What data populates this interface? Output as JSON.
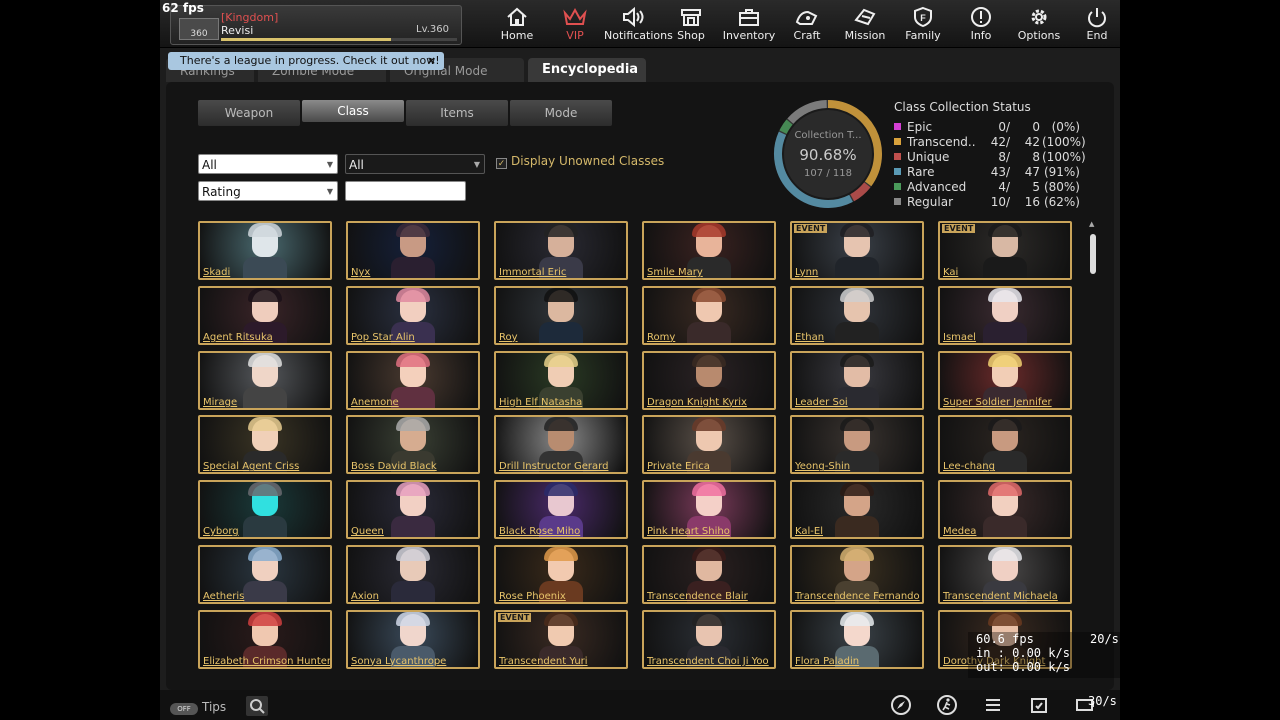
{
  "fps": "62 fps",
  "profile": {
    "guild": "[Kingdom]",
    "name": "Revisi",
    "level": "Lv.360",
    "badge": "360",
    "xp_fraction": 0.72
  },
  "nav": [
    {
      "label": "Home",
      "icon": "home-icon"
    },
    {
      "label": "VIP",
      "icon": "crown-icon"
    },
    {
      "label": "Notifications",
      "icon": "speaker-icon"
    },
    {
      "label": "Shop",
      "icon": "shop-icon"
    },
    {
      "label": "Inventory",
      "icon": "bag-icon"
    },
    {
      "label": "Craft",
      "icon": "craft-icon"
    },
    {
      "label": "Mission",
      "icon": "mission-icon"
    },
    {
      "label": "Family",
      "icon": "family-icon"
    },
    {
      "label": "Info",
      "icon": "info-icon"
    },
    {
      "label": "Options",
      "icon": "gear-icon"
    },
    {
      "label": "End",
      "icon": "power-icon"
    }
  ],
  "tooltip": {
    "text": "There's a league in progress. Check it out now!",
    "close": "×"
  },
  "main_tabs": [
    "Rankings",
    "Zombie Mode",
    "Original Mode",
    "Encyclopedia"
  ],
  "sub_tabs": [
    "Weapon",
    "Class",
    "Items",
    "Mode"
  ],
  "filters": {
    "filter1": "All",
    "filter2": "All",
    "sort": "Rating",
    "search_value": "",
    "display_unowned": "Display Unowned Classes",
    "checkmark": "✓"
  },
  "collection": {
    "label": "Collection T...",
    "percent": "90.68%",
    "count": "107 / 118"
  },
  "status": {
    "title": "Class Collection Status",
    "rows": [
      {
        "name": "Epic",
        "owned": "0/",
        "total": "0",
        "pct": "(0%)",
        "color": "#d43fd4"
      },
      {
        "name": "Transcend..",
        "owned": "42/",
        "total": "42",
        "pct": "(100%)",
        "color": "#d9a23c"
      },
      {
        "name": "Unique",
        "owned": "8/",
        "total": "8",
        "pct": "(100%)",
        "color": "#c0504d"
      },
      {
        "name": "Rare",
        "owned": "43/",
        "total": "47",
        "pct": "(91%)",
        "color": "#5a9ab5"
      },
      {
        "name": "Advanced",
        "owned": "4/",
        "total": "5",
        "pct": "(80%)",
        "color": "#4a9a5a"
      },
      {
        "name": "Regular",
        "owned": "10/",
        "total": "16",
        "pct": "(62%)",
        "color": "#888888"
      }
    ]
  },
  "classes": [
    {
      "name": "Skadi",
      "event": ""
    },
    {
      "name": "Nyx",
      "event": ""
    },
    {
      "name": "Immortal Eric",
      "event": ""
    },
    {
      "name": "Smile Mary",
      "event": ""
    },
    {
      "name": "Lynn",
      "event": "EVENT"
    },
    {
      "name": "Kai",
      "event": "EVENT"
    },
    {
      "name": "Agent Ritsuka",
      "event": ""
    },
    {
      "name": "Pop Star Alin",
      "event": ""
    },
    {
      "name": "Roy",
      "event": ""
    },
    {
      "name": "Romy",
      "event": ""
    },
    {
      "name": "Ethan",
      "event": ""
    },
    {
      "name": "Ismael",
      "event": ""
    },
    {
      "name": "Mirage",
      "event": ""
    },
    {
      "name": "Anemone",
      "event": ""
    },
    {
      "name": "High Elf Natasha",
      "event": ""
    },
    {
      "name": "Dragon Knight Kyrix",
      "event": ""
    },
    {
      "name": "Leader Soi",
      "event": ""
    },
    {
      "name": "Super Soldier Jennifer",
      "event": ""
    },
    {
      "name": "Special Agent Criss",
      "event": ""
    },
    {
      "name": "Boss David Black",
      "event": ""
    },
    {
      "name": "Drill Instructor Gerard",
      "event": ""
    },
    {
      "name": "Private Erica",
      "event": ""
    },
    {
      "name": "Yeong-Shin",
      "event": ""
    },
    {
      "name": "Lee-chang",
      "event": ""
    },
    {
      "name": "Cyborg",
      "event": ""
    },
    {
      "name": "Queen",
      "event": ""
    },
    {
      "name": "Black Rose Miho",
      "event": ""
    },
    {
      "name": "Pink Heart Shiho",
      "event": ""
    },
    {
      "name": "Kal-El",
      "event": ""
    },
    {
      "name": "Medea",
      "event": ""
    },
    {
      "name": "Aetheris",
      "event": ""
    },
    {
      "name": "Axion",
      "event": ""
    },
    {
      "name": "Rose Phoenix",
      "event": ""
    },
    {
      "name": "Transcendence Blair",
      "event": ""
    },
    {
      "name": "Transcendence Fernando",
      "event": ""
    },
    {
      "name": "Transcendent Michaela",
      "event": ""
    },
    {
      "name": "Elizabeth Crimson Hunter",
      "event": ""
    },
    {
      "name": "Sonya Lycanthrope",
      "event": ""
    },
    {
      "name": "Transcendent Yuri",
      "event": "EVENT"
    },
    {
      "name": "Transcendent Choi Ji Yoo",
      "event": ""
    },
    {
      "name": "Flora Paladin",
      "event": ""
    },
    {
      "name": "Dorothy Dark Knight",
      "event": ""
    }
  ],
  "bottom": {
    "tips": "Tips",
    "toggle": "OFF"
  },
  "netstats": {
    "fps": "60.6 fps",
    "rate": "20/s",
    "in": "in : 0.00 k/s",
    "out": "out: 0.00 k/s",
    "rate2": "30/s"
  },
  "colors": {
    "accent_gold": "#c9a45a",
    "vip_red": "#e05050"
  }
}
